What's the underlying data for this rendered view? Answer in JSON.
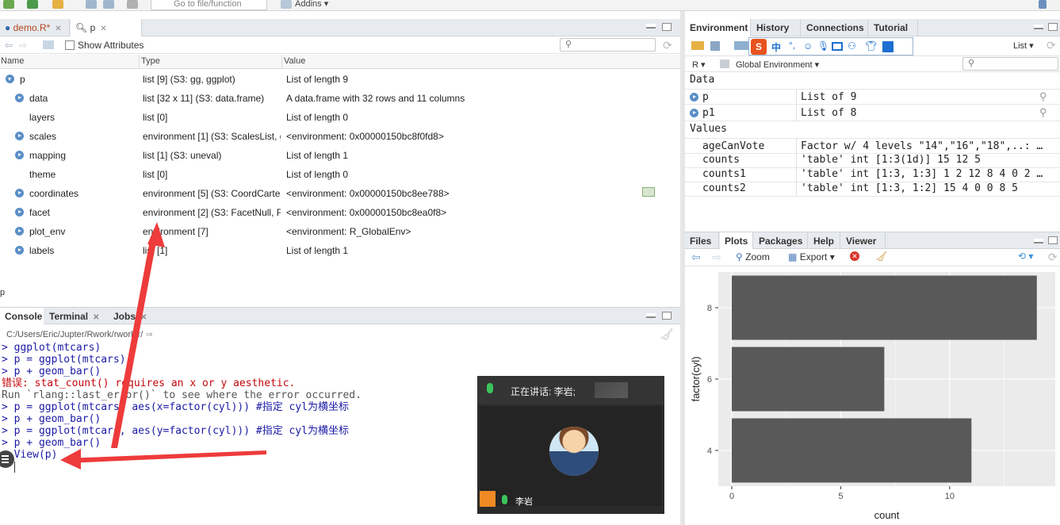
{
  "toolbar": {
    "goto_placeholder": "Go to file/function",
    "addins_label": "Addins"
  },
  "source_tabs": [
    {
      "label": "demo.R*"
    },
    {
      "label": "p"
    }
  ],
  "viewer": {
    "show_attributes_label": "Show Attributes",
    "columns": [
      "Name",
      "Type",
      "Value"
    ],
    "rows": [
      {
        "name": "p",
        "type": "list [9] (S3: gg, ggplot)",
        "value": "List of length 9"
      },
      {
        "name": "data",
        "type": "list [32 x 11] (S3: data.frame)",
        "value": "A data.frame with 32 rows and 11 columns"
      },
      {
        "name": "layers",
        "type": "list [0]",
        "value": "List of length 0"
      },
      {
        "name": "scales",
        "type": "environment [1] (S3: ScalesList, gg",
        "value": "<environment: 0x00000150bc8f0fd8>"
      },
      {
        "name": "mapping",
        "type": "list [1] (S3: uneval)",
        "value": "List of length 1"
      },
      {
        "name": "theme",
        "type": "list [0]",
        "value": "List of length 0"
      },
      {
        "name": "coordinates",
        "type": "environment [5] (S3: CoordCartes",
        "value": "<environment: 0x00000150bc8ee788>"
      },
      {
        "name": "facet",
        "type": "environment [2] (S3: FacetNull, Fa",
        "value": "<environment: 0x00000150bc8ea0f8>"
      },
      {
        "name": "plot_env",
        "type": "environment [7]",
        "value": "<environment: R_GlobalEnv>"
      },
      {
        "name": "labels",
        "type": "list [1]",
        "value": "List of length 1"
      }
    ],
    "footer": "p"
  },
  "console": {
    "tabs": [
      "Console",
      "Terminal",
      "Jobs"
    ],
    "path": "C:/Users/Eric/Jupter/Rwork/rwork/r/",
    "lines": [
      {
        "text": "> ggplot(mtcars)",
        "color": "blue"
      },
      {
        "text": "> p = ggplot(mtcars)",
        "color": "blue"
      },
      {
        "text": "> p + geom_bar()",
        "color": "blue"
      },
      {
        "text": "错误: stat_count() requires an x or y aesthetic.",
        "color": "red"
      },
      {
        "text": "Run `rlang::last_error()` to see where the error occurred.",
        "color": "gray"
      },
      {
        "text": "> p = ggplot(mtcars, aes(x=factor(cyl))) #指定 cyl为横坐标",
        "color": "blue"
      },
      {
        "text": "> p + geom_bar()",
        "color": "blue"
      },
      {
        "text": "> p = ggplot(mtcars, aes(y=factor(cyl))) #指定 cyl为横坐标",
        "color": "blue"
      },
      {
        "text": "> p + geom_bar()",
        "color": "blue"
      },
      {
        "text": "> View(p)",
        "color": "blue"
      }
    ]
  },
  "meeting": {
    "speaking_label": "正在讲话: 李岩;",
    "participant_name": "李岩"
  },
  "environment": {
    "tabs": [
      "Environment",
      "History",
      "Connections",
      "Tutorial"
    ],
    "view_mode": "List",
    "language": "R",
    "scope": "Global Environment",
    "sections": {
      "data_label": "Data",
      "values_label": "Values"
    },
    "data_rows": [
      {
        "name": "p",
        "value": "List of  9"
      },
      {
        "name": "p1",
        "value": "List of  8"
      }
    ],
    "value_rows": [
      {
        "name": "ageCanVote",
        "value": "Factor w/ 4 levels \"14\",\"16\",\"18\",..: …"
      },
      {
        "name": "counts",
        "value": "'table' int [1:3(1d)] 15 12 5"
      },
      {
        "name": "counts1",
        "value": "'table' int [1:3, 1:3] 1 2 12 8 4 0 2 …"
      },
      {
        "name": "counts2",
        "value": "'table' int [1:3, 1:2] 15 4 0 0 8 5"
      }
    ]
  },
  "plots": {
    "tabs": [
      "Files",
      "Plots",
      "Packages",
      "Help",
      "Viewer"
    ],
    "zoom_label": "Zoom",
    "export_label": "Export"
  },
  "chart_data": {
    "type": "bar",
    "orientation": "horizontal",
    "categories": [
      "4",
      "6",
      "8"
    ],
    "values": [
      11,
      7,
      14
    ],
    "xlabel": "count",
    "ylabel": "factor(cyl)",
    "x_ticks": [
      0,
      5,
      10
    ],
    "xlim": [
      0,
      14.7
    ],
    "bar_color": "#595959",
    "panel_color": "#ebebeb"
  }
}
